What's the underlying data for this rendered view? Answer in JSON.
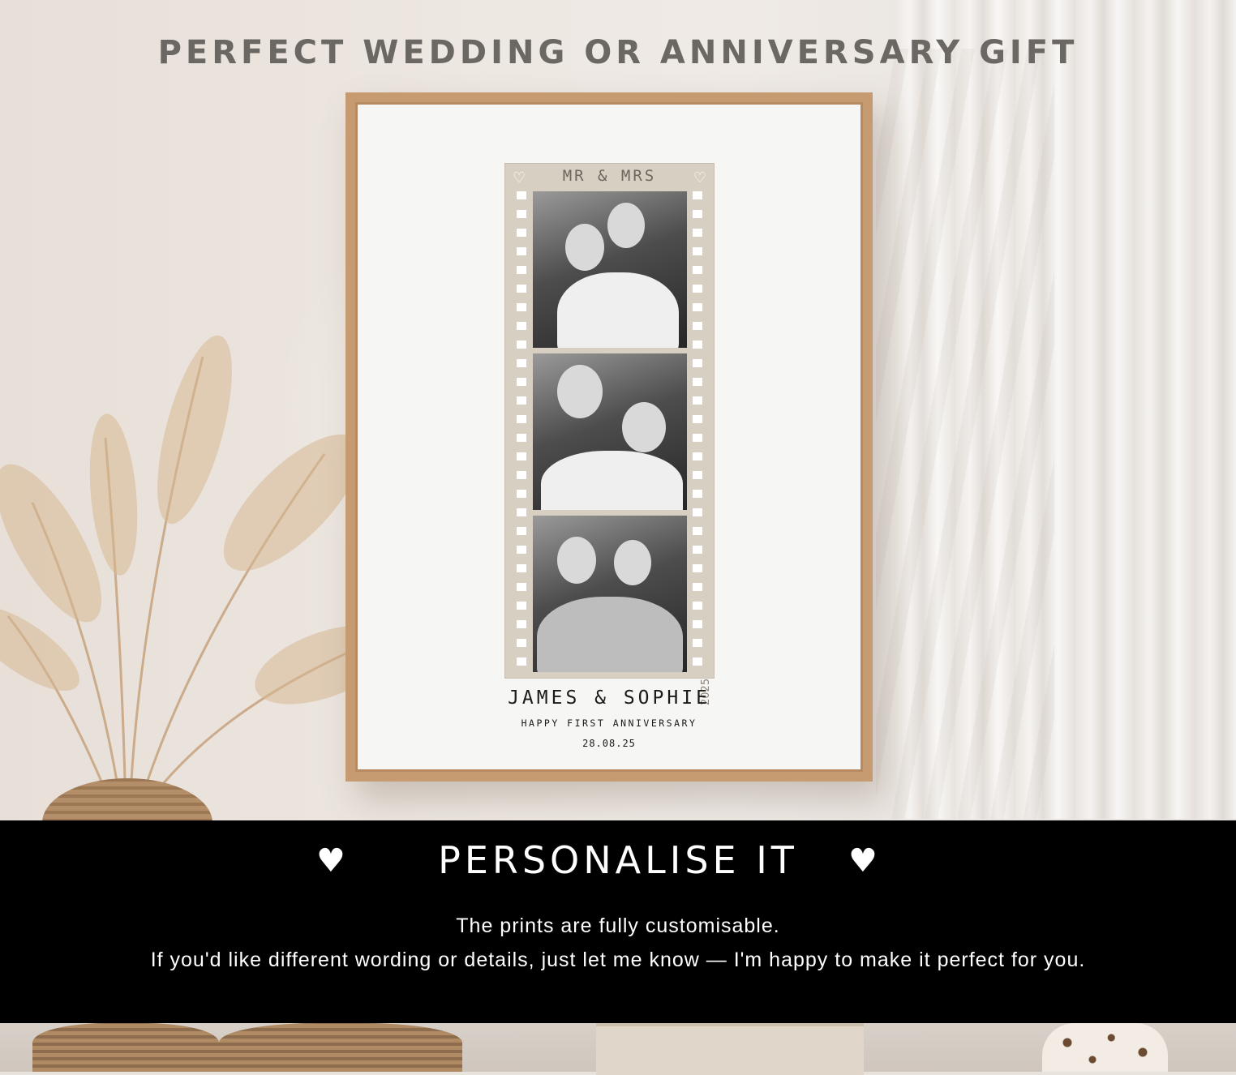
{
  "headline": "PERFECT WEDDING OR ANNIVERSARY GIFT",
  "print": {
    "strip_title": "MR & MRS",
    "year": "2025",
    "names": "JAMES & SOPHIE",
    "subtitle": "HAPPY FIRST ANNIVERSARY",
    "date": "28.08.25"
  },
  "banner": {
    "title": "PERSONALISE IT",
    "heart_icon": "heart-icon",
    "line1": "The prints are fully customisable.",
    "line2": "If you'd like different wording or details, just let me know — I'm happy to make it perfect for you."
  },
  "colors": {
    "frame": "#c79b72",
    "filmstrip": "#d7cfc2",
    "banner": "#000000"
  }
}
